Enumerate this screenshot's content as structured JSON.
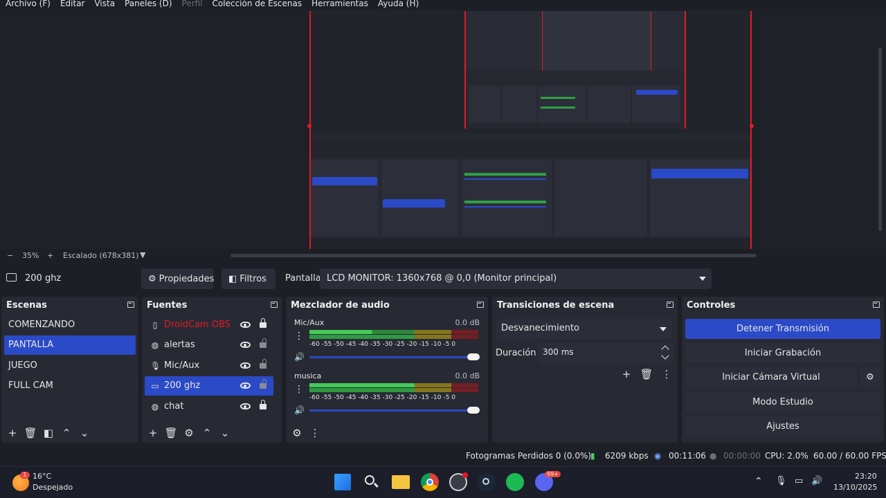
{
  "menu": [
    "Archivo (F)",
    "Editar",
    "Vista",
    "Paneles (D)",
    "Perfil",
    "Colección de Escenas",
    "Herramientas",
    "Ayuda (H)"
  ],
  "preview": {
    "zoom": "35%",
    "scaling": "Escalado (678x381)"
  },
  "source_toolbar": {
    "selected_source": "200 ghz",
    "properties_label": "Propiedades",
    "filters_label": "Filtros",
    "display_label": "Pantalla",
    "display_value": "LCD MONITOR: 1360x768 @ 0,0 (Monitor principal)"
  },
  "scenes": {
    "title": "Escenas",
    "items": [
      "COMENZANDO",
      "PANTALLA",
      "JUEGO",
      "FULL CAM"
    ],
    "active_index": 1
  },
  "sources": {
    "title": "Fuentes",
    "items": [
      {
        "label": "DroidCam OBS",
        "icon": "camera-icon",
        "locked": true,
        "error": true
      },
      {
        "label": "alertas",
        "icon": "globe-icon",
        "locked": false
      },
      {
        "label": "Mic/Aux",
        "icon": "microphone-icon",
        "locked": false
      },
      {
        "label": "200 ghz",
        "icon": "monitor-icon",
        "locked": false,
        "active": true
      },
      {
        "label": "chat",
        "icon": "globe-icon",
        "locked": true
      }
    ]
  },
  "mixer": {
    "title": "Mezclador de audio",
    "channels": [
      {
        "name": "Mic/Aux",
        "db": "0.0 dB"
      },
      {
        "name": "musica",
        "db": "0.0 dB"
      }
    ],
    "ticks": [
      "-60",
      "-55",
      "-50",
      "-45",
      "-40",
      "-35",
      "-30",
      "-25",
      "-20",
      "-15",
      "-10",
      "-5",
      "0"
    ]
  },
  "transitions": {
    "title": "Transiciones de escena",
    "selected": "Desvanecimiento",
    "duration_label": "Duración",
    "duration_value": "300 ms"
  },
  "controls": {
    "title": "Controles",
    "buttons": [
      "Detener Transmisión",
      "Iniciar Grabación",
      "Iniciar Cámara Virtual",
      "Modo Estudio",
      "Ajustes"
    ]
  },
  "status": {
    "dropped": "Fotogramas Perdidos 0 (0.0%)",
    "bitrate": "6209 kbps",
    "stream_time": "00:11:06",
    "rec_time": "00:00:00",
    "cpu": "CPU: 2.0%",
    "fps": "60.00 / 60.00 FPS"
  },
  "taskbar": {
    "weather_temp": "16°C",
    "weather_desc": "Despejado",
    "weather_badge": "1",
    "discord_badge": "99+",
    "time": "23:20",
    "date": "13/10/2025"
  },
  "colors": {
    "accent": "#2b4ac7",
    "recording_border": "#e01b24",
    "panel": "#272a33",
    "background": "#1d1f26"
  }
}
